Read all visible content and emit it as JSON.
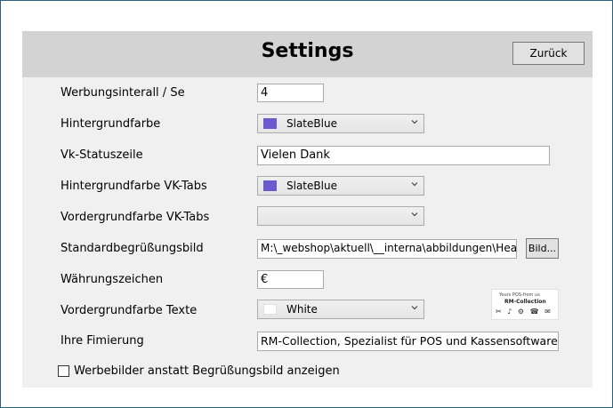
{
  "window": {
    "title": "Settings"
  },
  "header": {
    "back_label": "Zurück"
  },
  "fields": {
    "ad_interval": {
      "label": "Werbungsinterall / Se",
      "value": "4"
    },
    "background_color": {
      "label": "Hintergrundfarbe",
      "value": "SlateBlue",
      "swatch": "#6a5acd"
    },
    "status_line": {
      "label": "Vk-Statuszeile",
      "value": "Vielen Dank"
    },
    "tabs_background": {
      "label": "Hintergrundfarbe VK-Tabs",
      "value": "SlateBlue",
      "swatch": "#6a5acd"
    },
    "tabs_foreground": {
      "label": "Vordergrundfarbe VK-Tabs",
      "value": ""
    },
    "welcome_image": {
      "label": "Standardbegrüßungsbild",
      "value": "M:\\_webshop\\aktuell\\__interna\\abbildungen\\HeaderLa",
      "button": "Bild..."
    },
    "currency": {
      "label": "Währungszeichen",
      "value": "€"
    },
    "text_foreground": {
      "label": "Vordergrundfarbe Texte",
      "value": "White",
      "swatch": "#ffffff"
    },
    "company": {
      "label": "Ihre Fimierung",
      "value": "RM-Collection, Spezialist für POS und Kassensoftware"
    }
  },
  "show_ad_images": {
    "label": "Werbebilder anstatt Begrüßungsbild anzeigen",
    "checked": false
  },
  "preview": {
    "line1": "Yours POS-from us",
    "line2": "RM-Collection",
    "line3": "✂ ♪ ⚙ ☎ ✉"
  }
}
